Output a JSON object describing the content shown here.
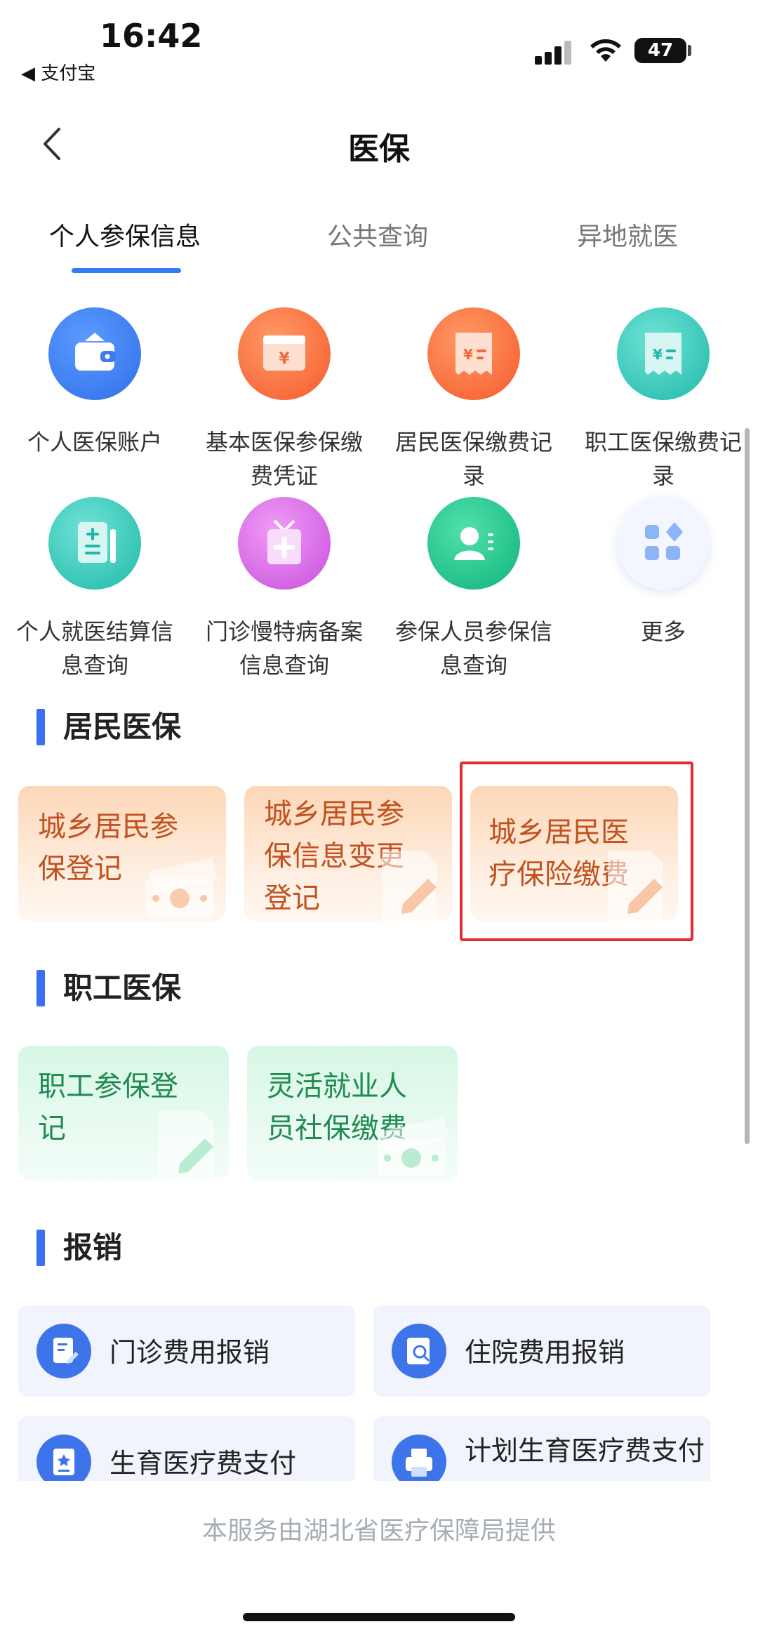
{
  "status": {
    "time": "16:42",
    "back_app": "◀ 支付宝",
    "battery": "47"
  },
  "nav": {
    "title": "医保"
  },
  "tabs": [
    "个人参保信息",
    "公共查询",
    "异地就医"
  ],
  "services": [
    {
      "label": "个人医保账户",
      "icon": "wallet-icon",
      "color": "#3e7bf0"
    },
    {
      "label": "基本医保参保缴费凭证",
      "icon": "receipt-yuan-icon",
      "color": "#fb6b3d"
    },
    {
      "label": "居民医保缴费记录",
      "icon": "bill-yuan-icon",
      "color": "#fb6b3d"
    },
    {
      "label": "职工医保缴费记录",
      "icon": "bill-yuan-icon",
      "color": "#2fc6b7"
    },
    {
      "label": "个人就医结算信息查询",
      "icon": "medical-record-icon",
      "color": "#2fc6b7"
    },
    {
      "label": "门诊慢特病备案信息查询",
      "icon": "medical-card-icon",
      "color": "#d76ae6"
    },
    {
      "label": "参保人员参保信息查询",
      "icon": "person-card-icon",
      "color": "#1bc488"
    },
    {
      "label": "更多",
      "icon": "more-grid-icon",
      "color": "#eef3ff"
    }
  ],
  "sections": {
    "resident": {
      "title": "居民医保",
      "cards": [
        "城乡居民参保登记",
        "城乡居民参保信息变更登记",
        "城乡居民医疗保险缴费"
      ]
    },
    "employee": {
      "title": "职工医保",
      "cards": [
        "职工参保登记",
        "灵活就业人员社保缴费"
      ]
    },
    "reimburse": {
      "title": "报销",
      "items": [
        "门诊费用报销",
        "住院费用报销",
        "生育医疗费支付",
        "计划生育医疗费支付"
      ]
    }
  },
  "footer": "本服务由湖北省医疗保障局提供",
  "colors": {
    "accent": "#2f7cf6",
    "highlight": "#e8282b"
  }
}
